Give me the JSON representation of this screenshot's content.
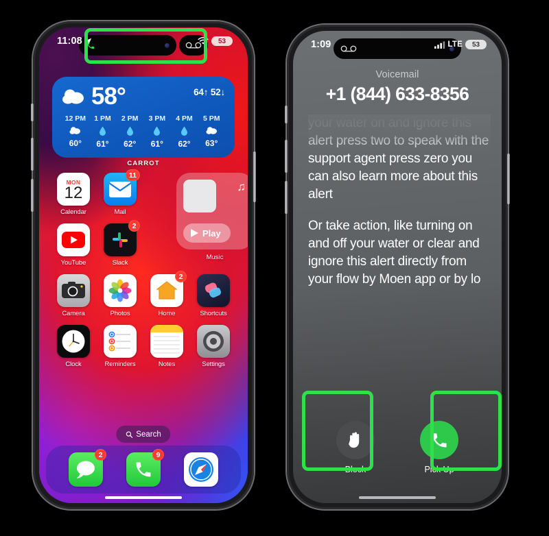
{
  "left_phone": {
    "status_bar": {
      "time": "11:08",
      "location_icon": "location-arrow-icon",
      "wifi_icon": "wifi-icon",
      "battery": "53"
    },
    "dynamic_island": {
      "phone_icon": "phone-call-icon",
      "voicemail_icon": "voicemail-icon",
      "camera_dot": "front-camera-dot"
    },
    "highlight": {
      "color": "#2ee04a",
      "target": "dynamic-island-call-and-voicemail"
    },
    "weather_widget": {
      "condition_icon": "cloud-icon",
      "current_temp": "58°",
      "high": "64↑",
      "low": "52↓",
      "widget_label": "CARROT",
      "hours": [
        {
          "time": "12 PM",
          "icon": "cloud-icon",
          "temp": "60°"
        },
        {
          "time": "1 PM",
          "icon": "raindrop-icon",
          "temp": "61°"
        },
        {
          "time": "2 PM",
          "icon": "raindrop-icon",
          "temp": "62°"
        },
        {
          "time": "3 PM",
          "icon": "raindrop-icon",
          "temp": "61°"
        },
        {
          "time": "4 PM",
          "icon": "raindrop-icon",
          "temp": "62°"
        },
        {
          "time": "5 PM",
          "icon": "cloud-icon",
          "temp": "63°"
        }
      ]
    },
    "apps": {
      "row1": [
        {
          "label": "Calendar",
          "icon": "calendar-icon",
          "day_name": "MON",
          "day_number": "12",
          "badge": ""
        },
        {
          "label": "Mail",
          "icon": "mail-icon",
          "badge": "11"
        }
      ],
      "row2": [
        {
          "label": "YouTube",
          "icon": "youtube-icon",
          "badge": ""
        },
        {
          "label": "Slack",
          "icon": "slack-icon",
          "badge": "2"
        }
      ],
      "row3": [
        {
          "label": "Camera",
          "icon": "camera-icon",
          "badge": ""
        },
        {
          "label": "Photos",
          "icon": "photos-icon",
          "badge": ""
        },
        {
          "label": "Home",
          "icon": "home-icon",
          "badge": "2"
        },
        {
          "label": "Shortcuts",
          "icon": "shortcuts-icon",
          "badge": ""
        }
      ],
      "row4": [
        {
          "label": "Clock",
          "icon": "clock-icon",
          "badge": ""
        },
        {
          "label": "Reminders",
          "icon": "reminders-icon",
          "badge": ""
        },
        {
          "label": "Notes",
          "icon": "notes-icon",
          "badge": ""
        },
        {
          "label": "Settings",
          "icon": "settings-gear-icon",
          "badge": ""
        }
      ]
    },
    "music_widget": {
      "label": "Music",
      "play_label": "Play",
      "play_icon": "play-triangle-icon",
      "note_icon": "music-note-icon",
      "album_art": "album-art-placeholder"
    },
    "search_pill": {
      "label": "Search",
      "icon": "search-icon"
    },
    "dock": [
      {
        "label": "Messages",
        "icon": "messages-icon",
        "badge": "2"
      },
      {
        "label": "Phone",
        "icon": "phone-icon",
        "badge": "9"
      },
      {
        "label": "Safari",
        "icon": "safari-compass-icon",
        "badge": ""
      }
    ]
  },
  "right_phone": {
    "status_bar": {
      "time": "1:09",
      "cellular_icon": "cellular-bars-icon",
      "network": "LTE",
      "battery": "53"
    },
    "dynamic_island": {
      "voicemail_icon": "voicemail-icon",
      "camera_dot": "front-camera-dot"
    },
    "voicemail": {
      "title": "Voicemail",
      "number": "+1 (844) 633-8356",
      "transcript_paragraph_1": "your water on and ignore this alert press two to speak with the support agent press zero you can also learn more about this alert",
      "transcript_paragraph_2": "Or take action, like turning on and off your water or clear and ignore this alert directly from your flow by Moen app or by lo"
    },
    "actions": [
      {
        "label": "Block",
        "icon": "hand-stop-icon",
        "highlighted": true
      },
      {
        "label": "Pick Up",
        "icon": "phone-icon",
        "highlighted": true
      }
    ],
    "highlight_color": "#2ee04a"
  }
}
